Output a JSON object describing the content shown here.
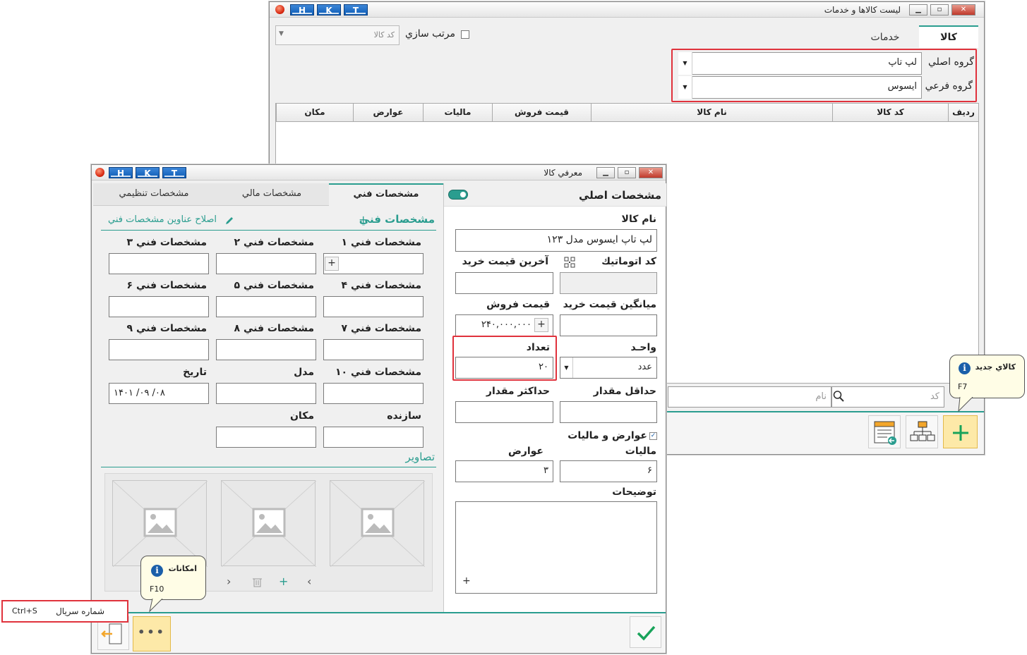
{
  "list_window": {
    "title": "ليست كالاها و خدمات",
    "hkt": [
      "H",
      "K",
      "T"
    ],
    "tabs": {
      "goods": "كالا",
      "services": "خدمات"
    },
    "sort_label": "مرتب سازي",
    "code_placeholder": "كد كالا",
    "main_group_label": "گروه اصلي",
    "main_group_value": "لپ تاپ",
    "sub_group_label": "گروه فرعي",
    "sub_group_value": "ايسوس",
    "columns": [
      "رديف",
      "كد كالا",
      "نام كالا",
      "قيمت فروش",
      "ماليات",
      "عوارض",
      "مكان"
    ],
    "search_code_placeholder": "كد",
    "search_name_placeholder": "نام",
    "new_item_tip": {
      "title": "كالاي جديد",
      "shortcut": "F7"
    }
  },
  "form_window": {
    "title": "معرفي كالا",
    "hkt": [
      "H",
      "K",
      "T"
    ],
    "main_section": "مشخصات اصلي",
    "tabs": {
      "technical": "مشخصات فني",
      "financial": "مشخصات مالي",
      "settings": "مشخصات تنظيمي"
    },
    "fields": {
      "name_label": "نام كالا",
      "name_value": "لپ تاپ ايسوس مدل ۱۲۳",
      "auto_code_label": "كد اتوماتيك",
      "last_price_label": "آخرين قيمت خريد",
      "avg_price_label": "ميانگين قيمت خريد",
      "sale_price_label": "قيمت فروش",
      "sale_price_value": "۲۴۰,۰۰۰,۰۰۰",
      "unit_label": "واحـد",
      "unit_value": "عدد",
      "count_label": "تعداد",
      "count_value": "۲۰",
      "min_label": "حداقل مقدار",
      "max_label": "حداكثر مقدار",
      "tax_section_label": "عوارض و ماليات",
      "tax_label": "ماليات",
      "tax_value": "۶",
      "duty_label": "عوارض",
      "duty_value": "۳",
      "desc_label": "توضيحات"
    },
    "technical": {
      "header": "مشخصات فني",
      "fix_titles": "اصلاح عناوين مشخصات فني",
      "spec1": "مشخصات فني ۱",
      "spec2": "مشخصات فني ۲",
      "spec3": "مشخصات فني ۳",
      "spec4": "مشخصات فني ۴",
      "spec5": "مشخصات فني ۵",
      "spec6": "مشخصات فني ۶",
      "spec7": "مشخصات فني ۷",
      "spec8": "مشخصات فني ۸",
      "spec9": "مشخصات فني ۹",
      "spec10": "مشخصات فني ۱۰",
      "model": "مدل",
      "date": "تاريخ",
      "date_value": "۱۴۰۱  /۰۹  /۰۸",
      "maker": "سازنده",
      "place": "مكان",
      "images": "تصاوير"
    },
    "options_tip": {
      "title": "امكانات",
      "shortcut": "F10"
    },
    "serial_menu": {
      "label": "شماره سريال",
      "shortcut": "Ctrl+S"
    }
  }
}
